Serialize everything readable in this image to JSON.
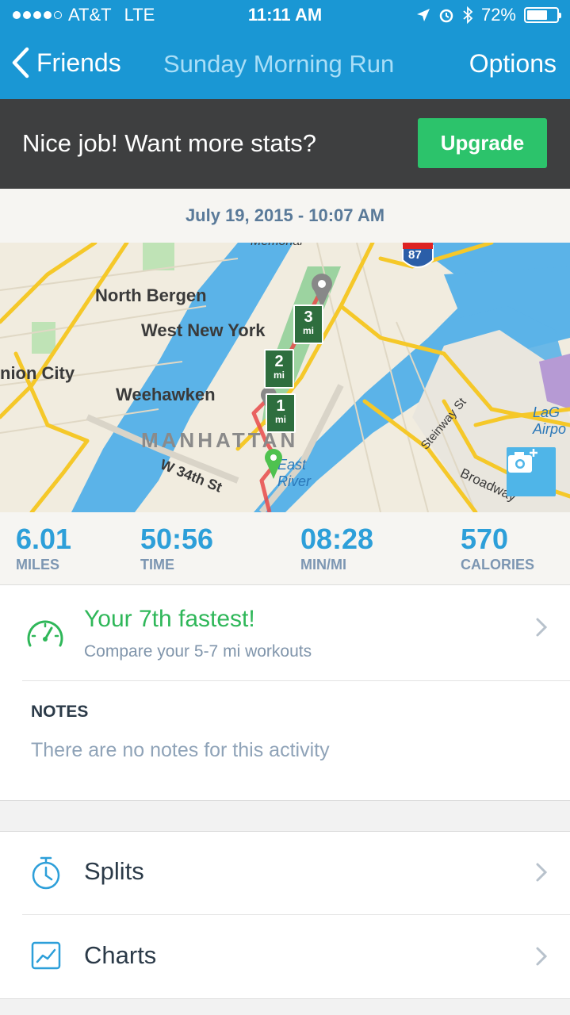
{
  "status_bar": {
    "carrier": "AT&T",
    "network": "LTE",
    "time": "11:11 AM",
    "battery": "72%",
    "battery_level": 0.72
  },
  "nav": {
    "back_label": "Friends",
    "title": "Sunday Morning Run",
    "options_label": "Options"
  },
  "promo": {
    "message": "Nice job! Want more stats?",
    "button_label": "Upgrade",
    "button_color": "#2cc36b"
  },
  "activity_date": "July 19, 2015 - 10:07 AM",
  "map": {
    "labels": {
      "north_bergen": "North Bergen",
      "west_new_york": "West New York",
      "union_city": "nion City",
      "weehawken": "Weehawken",
      "manhattan": "MANHATTAN",
      "w34th": "W 34th St",
      "east_river": "East River",
      "steinway": "Steinway St",
      "broadway": "Broadway",
      "laguardia": "LaG Airpo",
      "interstate": "87",
      "memorial": "Memorial"
    },
    "mile_markers": [
      {
        "number": "3",
        "unit": "mi"
      },
      {
        "number": "2",
        "unit": "mi"
      },
      {
        "number": "1",
        "unit": "mi"
      }
    ]
  },
  "stats": [
    {
      "value": "6.01",
      "label": "MILES"
    },
    {
      "value": "50:56",
      "label": "TIME"
    },
    {
      "value": "08:28",
      "label": "MIN/MI"
    },
    {
      "value": "570",
      "label": "CALORIES"
    }
  ],
  "fastest": {
    "headline": "Your 7th fastest!",
    "subtitle": "Compare your 5-7 mi workouts",
    "icon": "speedometer-icon"
  },
  "notes": {
    "heading": "NOTES",
    "empty_text": "There are no notes for this activity"
  },
  "menu": [
    {
      "label": "Splits",
      "icon": "stopwatch-icon"
    },
    {
      "label": "Charts",
      "icon": "chart-icon"
    }
  ],
  "colors": {
    "nav_bg": "#1a97d4",
    "accent_blue": "#2d9fd9",
    "accent_green": "#2fb759",
    "promo_bg": "#3e3f40"
  }
}
